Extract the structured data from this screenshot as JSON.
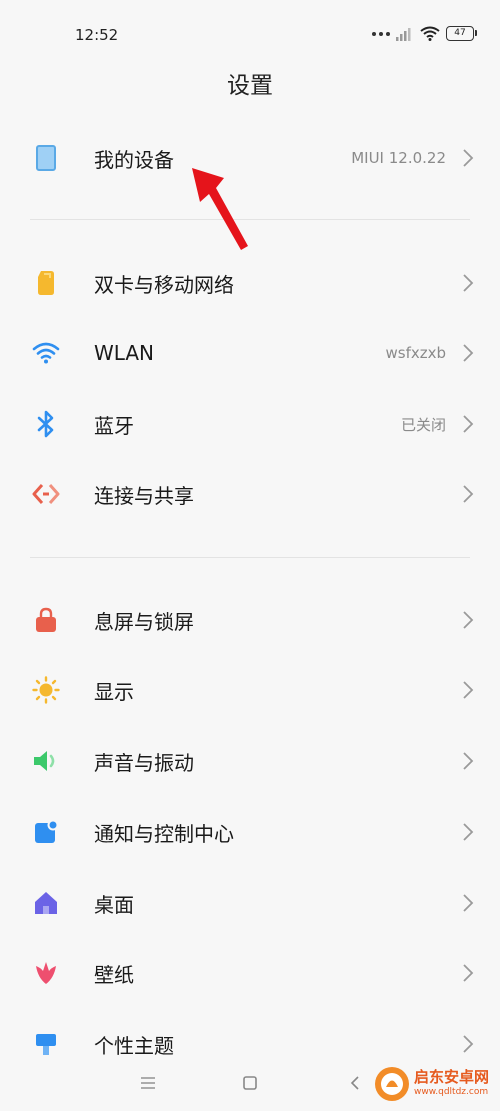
{
  "status_bar": {
    "time": "12:52",
    "battery": "47"
  },
  "header": {
    "title": "设置"
  },
  "settings": {
    "my_device": {
      "label": "我的设备",
      "value": "MIUI 12.0.22",
      "icon": "tablet-icon"
    },
    "dual_sim": {
      "label": "双卡与移动网络",
      "icon": "sim-card-icon"
    },
    "wlan": {
      "label": "WLAN",
      "value": "wsfxzxb",
      "icon": "wifi-icon"
    },
    "bluetooth": {
      "label": "蓝牙",
      "value": "已关闭",
      "icon": "bluetooth-icon"
    },
    "connection_sharing": {
      "label": "连接与共享",
      "icon": "share-icon"
    },
    "lock_screen": {
      "label": "息屏与锁屏",
      "icon": "lock-icon"
    },
    "display": {
      "label": "显示",
      "icon": "sun-icon"
    },
    "sound": {
      "label": "声音与振动",
      "icon": "speaker-icon"
    },
    "notifications": {
      "label": "通知与控制中心",
      "icon": "notification-icon"
    },
    "desktop": {
      "label": "桌面",
      "icon": "home-icon"
    },
    "wallpaper": {
      "label": "壁纸",
      "icon": "flower-icon"
    },
    "themes": {
      "label": "个性主题",
      "icon": "brush-icon"
    }
  },
  "colors": {
    "device": "#5aa9e6",
    "sim": "#f5b82e",
    "wifi": "#2f8ff0",
    "bluetooth": "#2f8ff0",
    "share": "#e8604c",
    "lock": "#e8604c",
    "sun": "#f5b82e",
    "sound": "#3cc96b",
    "notify": "#2f8ff0",
    "home": "#6b63e6",
    "flower": "#ee4f6f",
    "brush": "#2f8ff0",
    "annotation": "#e5141b"
  },
  "watermark": {
    "site_name": "启东安卓网",
    "url": "www.qdltdz.com"
  }
}
